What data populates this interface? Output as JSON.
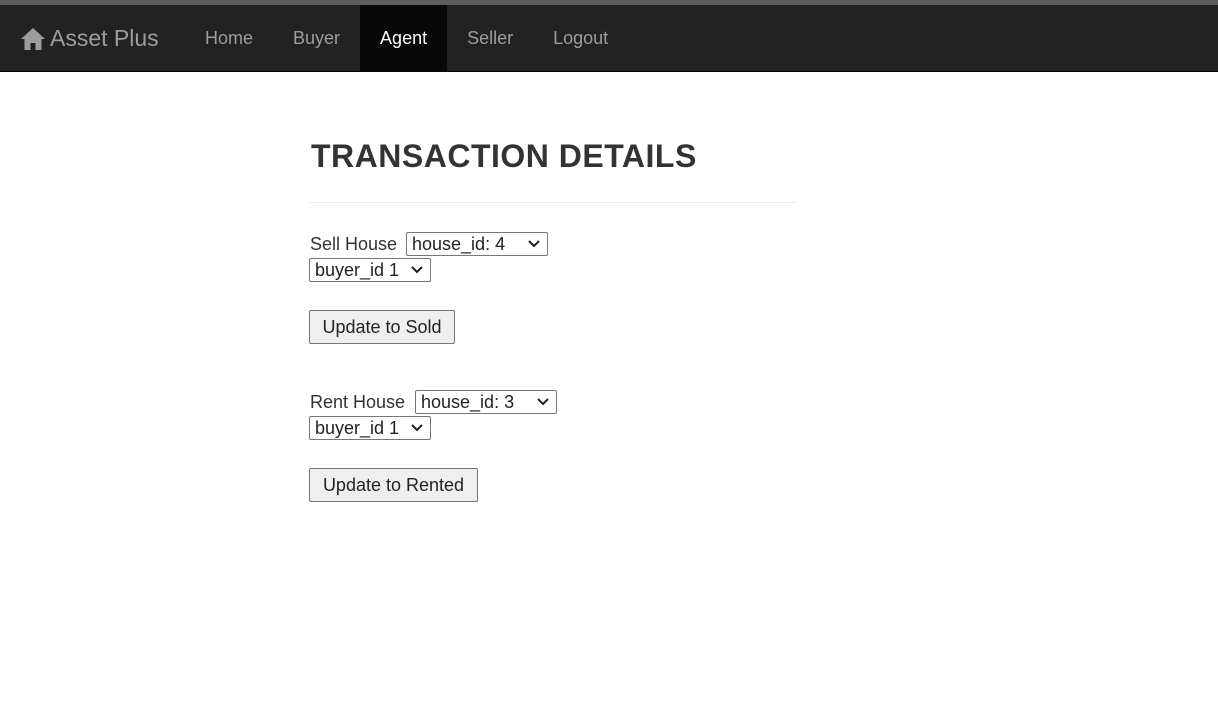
{
  "navbar": {
    "brand_icon": "home-icon",
    "brand": "Asset Plus",
    "items": [
      {
        "label": "Home",
        "active": false
      },
      {
        "label": "Buyer",
        "active": false
      },
      {
        "label": "Agent",
        "active": true
      },
      {
        "label": "Seller",
        "active": false
      },
      {
        "label": "Logout",
        "active": false
      }
    ],
    "colors": {
      "background": "#222222",
      "active_background": "#080808",
      "text": "#9d9d9d",
      "active_text": "#ffffff"
    }
  },
  "page": {
    "title": "TRANSACTION DETAILS",
    "sell": {
      "label": "Sell House",
      "house_select": "house_id: 4",
      "buyer_select": "buyer_id 1",
      "button": "Update to Sold"
    },
    "rent": {
      "label": "Rent House",
      "house_select": "house_id: 3",
      "buyer_select": "buyer_id 1",
      "button": "Update to Rented"
    }
  }
}
